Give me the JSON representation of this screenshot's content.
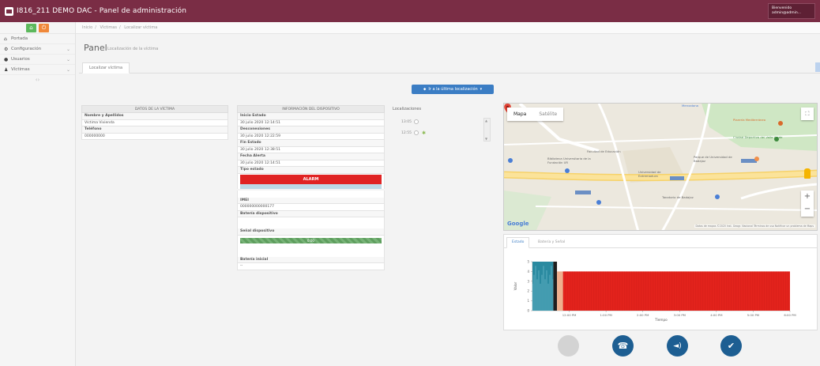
{
  "app": {
    "title": "I816_211 DEMO DAC - Panel de administración",
    "user_line1": "Bienvenido",
    "user_line2": "admin@admin..."
  },
  "sidebar": {
    "items": [
      {
        "label": "Portada",
        "icon": "home-icon"
      },
      {
        "label": "Configuración",
        "icon": "cogs-icon"
      },
      {
        "label": "Usuarios",
        "icon": "user-circle-icon"
      },
      {
        "label": "Víctimas",
        "icon": "users-icon"
      }
    ]
  },
  "breadcrumb": [
    "Inicio",
    "Víctimas",
    "Localizar víctima"
  ],
  "page": {
    "title": "Panel",
    "subtitle": "Localización de la víctima",
    "tab": "Localizar víctima",
    "goto_button": "Ir a la última localización"
  },
  "victim": {
    "header": "DATOS DE LA VÍCTIMA",
    "rows": [
      {
        "key": "Nombre y Apellidos",
        "value": "Víctima Vivienda"
      },
      {
        "key": "Teléfono",
        "value": "000000000"
      }
    ]
  },
  "device": {
    "header": "INFORMACIÓN DEL DISPOSITIVO",
    "rows": [
      {
        "key": "Inicio Estado",
        "value": "30 julio 2020 12:14:51"
      },
      {
        "key": "Desconexiones",
        "value": "30 julio 2020 12:22:59"
      },
      {
        "key": "Fin Estado",
        "value": "30 julio 2020 12:38:51"
      },
      {
        "key": "Fecha Alerta",
        "value": "30 julio 2020 12:14:51"
      }
    ],
    "state_label": "Tipo estado",
    "alarm": "ALARM",
    "imei_label": "IMEI",
    "imei": "000000000000177",
    "battery_label": "Batería dispositivo",
    "signal_label": "Señal dispositivo",
    "signal_value": "0.00",
    "initial_battery_label": "Batería inicial",
    "initial_battery": "--"
  },
  "locations": {
    "title": "Localizaciones",
    "items": [
      "13:05",
      "12:55"
    ]
  },
  "map": {
    "tabs": [
      "Mapa",
      "Satélite"
    ],
    "labels": [
      {
        "text": "Facultad de Educación",
        "color": "#666"
      },
      {
        "text": "Biblioteca Universitaria de la Fundación UR",
        "color": "#666"
      },
      {
        "text": "Universidad de Extremadura",
        "color": "#666"
      },
      {
        "text": "Ciudad Deportiva del Valle Verde",
        "color": "#3d8a3d"
      },
      {
        "text": "Parque de Universidad de Badajoz",
        "color": "#666"
      },
      {
        "text": "Tanatorio de Badajoz",
        "color": "#666"
      },
      {
        "text": "Mercadona",
        "color": "#4a7fd6"
      },
      {
        "text": "Pizzería Mediterráneo",
        "color": "#d96a2b"
      }
    ],
    "attribution": "Datos de mapas ©2020 Inst. Geogr. Nacional  Términos de uso  Notificar un problema de Maps",
    "logo": "Google"
  },
  "chart_tabs": [
    "Estado",
    "Batería y Señal"
  ],
  "chart_data": {
    "type": "bar",
    "xlabel": "Tiempo",
    "ylabel": "Valor",
    "ylim": [
      0,
      5
    ],
    "yticks": [
      0,
      1,
      2,
      3,
      4,
      5
    ],
    "x_ticks": [
      "12:00 PM",
      "1:00 PM",
      "2:00 PM",
      "3:00 PM",
      "4:00 PM",
      "5:00 PM",
      "6:00 PM"
    ],
    "series": [
      {
        "color": "#2a8aa0",
        "segments": [
          {
            "start": "11:00 AM",
            "end": "11:34 AM",
            "value": 5
          }
        ]
      },
      {
        "color": "#1f1f1f",
        "segments": [
          {
            "start": "11:34 AM",
            "end": "11:40 AM",
            "value": 5
          }
        ]
      },
      {
        "color": "#f0b08e",
        "segments": [
          {
            "start": "11:40 AM",
            "end": "11:50 AM",
            "value": 4
          }
        ]
      },
      {
        "color": "#e3231c",
        "segments": [
          {
            "start": "11:50 AM",
            "end": "6:00 PM",
            "value": 4
          }
        ]
      }
    ]
  },
  "actions": [
    {
      "name": "disabled-action",
      "icon": "",
      "color": "#d3d3d3"
    },
    {
      "name": "call",
      "icon": "☎",
      "color": "#1d5e92"
    },
    {
      "name": "volume",
      "icon": "◄)",
      "color": "#1d5e92"
    },
    {
      "name": "confirm",
      "icon": "✔",
      "color": "#1d5e92"
    }
  ]
}
